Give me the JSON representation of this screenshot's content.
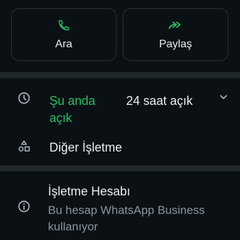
{
  "actions": {
    "call": {
      "label": "Ara",
      "icon": "phone-icon"
    },
    "share": {
      "label": "Paylaş",
      "icon": "forward-icon"
    }
  },
  "hours": {
    "status": "Şu anda açık",
    "schedule": "24 saat açık",
    "icon": "clock-icon",
    "expand_icon": "chevron-down-icon"
  },
  "category": {
    "label": "Diğer İşletme",
    "icon": "shapes-icon"
  },
  "business_account": {
    "title": "İşletme Hesabı",
    "description": "Bu hesap WhatsApp Business kullanıyor",
    "icon": "info-icon"
  },
  "colors": {
    "background": "#0b1014",
    "divider": "#1f272b",
    "accent_green": "#21c063",
    "text_primary": "#e9edef",
    "text_secondary": "#8696a0"
  }
}
